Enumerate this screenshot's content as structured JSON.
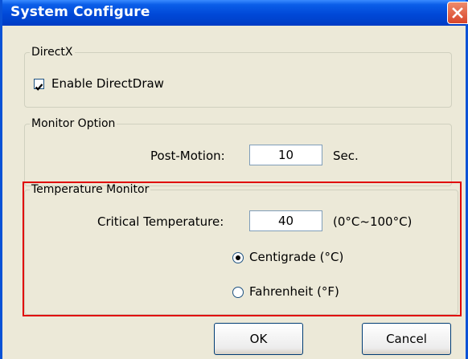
{
  "window": {
    "title": "System Configure"
  },
  "directx": {
    "legend": "DirectX",
    "enable_directdraw": {
      "label": "Enable DirectDraw",
      "checked": true
    }
  },
  "monitor_option": {
    "legend": "Monitor Option",
    "post_motion_label": "Post-Motion:",
    "post_motion_value": "10",
    "post_motion_unit": "Sec."
  },
  "temperature_monitor": {
    "legend": "Temperature Monitor",
    "critical_label": "Critical Temperature:",
    "critical_value": "40",
    "range_text": "(0°C~100°C)",
    "units": [
      {
        "label": "Centigrade (°C)",
        "selected": true
      },
      {
        "label": "Fahrenheit (°F)",
        "selected": false
      }
    ]
  },
  "buttons": {
    "ok_label": "OK",
    "cancel_label": "Cancel"
  },
  "colors": {
    "titlebar": "#0049d8",
    "dialog_bg": "#ece9d8",
    "highlight_annotation": "#e00000"
  }
}
